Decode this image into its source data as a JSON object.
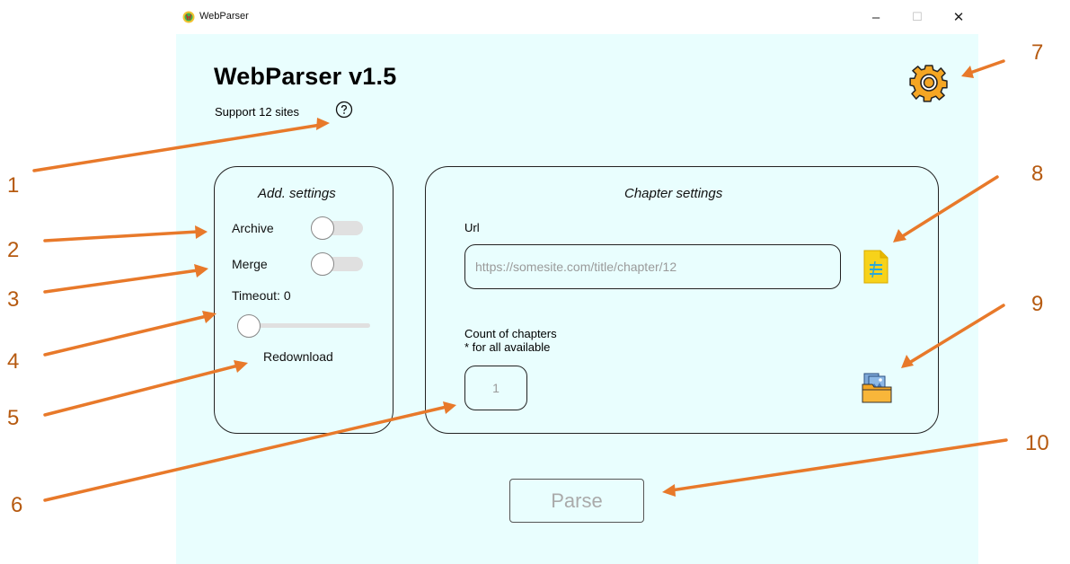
{
  "window": {
    "title": "WebParser",
    "minimize_glyph": "–",
    "maximize_glyph": "☐",
    "close_glyph": "✕"
  },
  "header": {
    "title": "WebParser v1.5",
    "support_text": "Support 12 sites",
    "help_icon": "question-circle-icon",
    "settings_icon": "gear-icon"
  },
  "add_settings": {
    "title": "Add. settings",
    "archive_label": "Archive",
    "archive_on": false,
    "merge_label": "Merge",
    "merge_on": false,
    "timeout_label": "Timeout: 0",
    "timeout_value": 0,
    "redownload_label": "Redownload"
  },
  "chapter_settings": {
    "title": "Chapter settings",
    "url_label": "Url",
    "url_placeholder": "https://somesite.com/title/chapter/12",
    "count_label_line1": "Count of chapters",
    "count_label_line2": "* for all available",
    "count_placeholder": "1",
    "file_icon": "document-file-icon",
    "folder_icon": "image-folder-icon"
  },
  "parse_button_label": "Parse",
  "annotations": [
    "1",
    "2",
    "3",
    "4",
    "5",
    "6",
    "7",
    "8",
    "9",
    "10"
  ],
  "colors": {
    "background": "#e9fefe",
    "arrow": "#e8792a",
    "annotation_number": "#b65a10"
  }
}
